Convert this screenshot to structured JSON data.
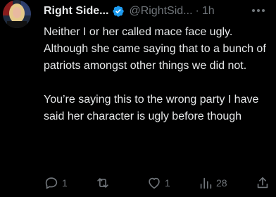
{
  "tweet": {
    "author_name": "Right Side...",
    "handle": "@RightSid...",
    "separator": "·",
    "time": "1h",
    "paragraphs": [
      "Neither I or her called mace face ugly. Although she came saying that to a bunch of patriots amongst other things we did not.",
      "You’re saying this to the wrong party I have said her character is ugly before though"
    ],
    "actions": {
      "replies": "1",
      "retweets": "",
      "likes": "1",
      "views": "28"
    }
  },
  "colors": {
    "background": "#000000",
    "text": "#e7e9ea",
    "muted": "#71767b",
    "verified_badge": "#1d9bf0"
  },
  "icons": [
    "avatar",
    "verified-badge-icon",
    "more-options-icon",
    "reply-icon",
    "retweet-icon",
    "like-icon",
    "views-icon",
    "share-icon"
  ]
}
